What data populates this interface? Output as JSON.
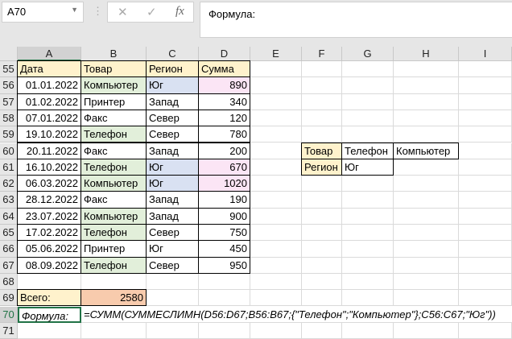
{
  "name_box": "A70",
  "formula_bar": "Формула:",
  "icons": {
    "cancel": "✕",
    "enter": "✓",
    "fx": "fx"
  },
  "columns": [
    "A",
    "B",
    "C",
    "D",
    "E",
    "F",
    "G",
    "H",
    "I"
  ],
  "rows_start": 55,
  "rows_end": 71,
  "headers": [
    "Дата",
    "Товар",
    "Регион",
    "Сумма"
  ],
  "data": [
    [
      "01.01.2022",
      "Компьютер",
      "Юг",
      "890"
    ],
    [
      "01.02.2022",
      "Принтер",
      "Запад",
      "340"
    ],
    [
      "07.01.2022",
      "Факс",
      "Север",
      "120"
    ],
    [
      "19.10.2022",
      "Телефон",
      "Север",
      "780"
    ],
    [
      "20.11.2022",
      "Факс",
      "Запад",
      "200"
    ],
    [
      "16.10.2022",
      "Телефон",
      "Юг",
      "670"
    ],
    [
      "06.03.2022",
      "Компьютер",
      "Юг",
      "1020"
    ],
    [
      "28.12.2022",
      "Факс",
      "Запад",
      "190"
    ],
    [
      "23.07.2022",
      "Компьютер",
      "Запад",
      "900"
    ],
    [
      "17.02.2022",
      "Телефон",
      "Север",
      "750"
    ],
    [
      "05.06.2022",
      "Принтер",
      "Юг",
      "450"
    ],
    [
      "08.09.2022",
      "Телефон",
      "Север",
      "950"
    ]
  ],
  "criteria": {
    "product_label": "Товар",
    "product_values": [
      "Телефон",
      "Компьютер"
    ],
    "region_label": "Регион",
    "region_value": "Юг"
  },
  "total": {
    "label": "Всего:",
    "value": "2580"
  },
  "formula_row": {
    "label": "Формула:",
    "text": "=СУММ(СУММЕСЛИМН(D56:D67;B56:B67;{\"Телефон\";\"Компьютер\"};C56:C67;\"Юг\"))"
  },
  "colors": {
    "header": "#FFF2CC",
    "green": "#E2EFDA",
    "blue": "#D9E1F2",
    "pink": "#FBE5F5",
    "orange": "#F8CBAD",
    "selection": "#217346"
  }
}
